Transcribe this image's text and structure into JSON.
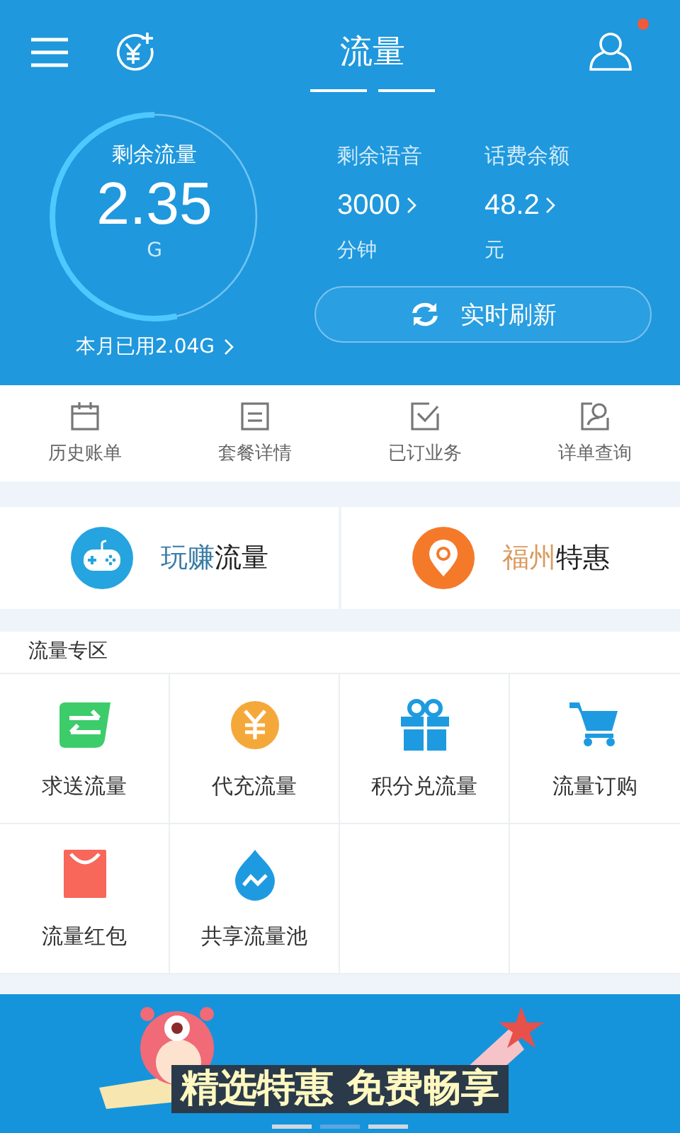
{
  "header": {
    "title": "流量",
    "notification_dot": true,
    "gauge": {
      "label": "剩余流量",
      "value": "2.35",
      "unit": "G",
      "level": 0.535
    },
    "used_link": "本月已用2.04G",
    "stats": [
      {
        "label": "剩余语音",
        "value": "3000",
        "unit": "分钟"
      },
      {
        "label": "话费余额",
        "value": "48.2",
        "unit": "元"
      }
    ],
    "refresh_button": "实时刷新"
  },
  "shortcuts": [
    {
      "kind": "calendar",
      "label": "历史账单"
    },
    {
      "kind": "list",
      "label": "套餐详情"
    },
    {
      "kind": "check",
      "label": "已订业务"
    },
    {
      "kind": "search",
      "label": "详单查询"
    }
  ],
  "promos": [
    {
      "kind": "gamepad",
      "highlight": "玩赚",
      "rest": "流量",
      "color": "#3a7ca5"
    },
    {
      "kind": "pin",
      "highlight": "福州",
      "rest": "特惠",
      "color": "#d99a5e"
    }
  ],
  "section": {
    "title": "流量专区",
    "items": [
      {
        "kind": "swap",
        "label": "求送流量"
      },
      {
        "kind": "yuan",
        "label": "代充流量"
      },
      {
        "kind": "gift",
        "label": "积分兑流量"
      },
      {
        "kind": "cart",
        "label": "流量订购"
      },
      {
        "kind": "bag",
        "label": "流量红包"
      },
      {
        "kind": "drop",
        "label": "共享流量池"
      }
    ]
  },
  "banner": {
    "text": "精选特惠 免费畅享",
    "dots": [
      {
        "selected": false
      },
      {
        "selected": true
      },
      {
        "selected": false
      }
    ]
  }
}
